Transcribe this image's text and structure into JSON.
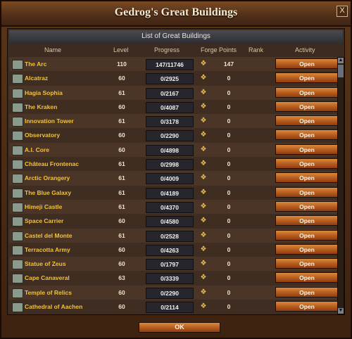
{
  "window": {
    "title": "Gedrog's Great Buildings",
    "close_label": "X"
  },
  "panel": {
    "title": "List of Great Buildings"
  },
  "columns": {
    "name": "Name",
    "level": "Level",
    "progress": "Progress",
    "forge_points": "Forge Points",
    "rank": "Rank",
    "activity": "Activity"
  },
  "rows": [
    {
      "name": "The Arc",
      "level": "110",
      "progress": "147/11746",
      "fp": "147",
      "action": "Open"
    },
    {
      "name": "Alcatraz",
      "level": "60",
      "progress": "0/2925",
      "fp": "0",
      "action": "Open"
    },
    {
      "name": "Hagia Sophia",
      "level": "61",
      "progress": "0/2167",
      "fp": "0",
      "action": "Open"
    },
    {
      "name": "The Kraken",
      "level": "60",
      "progress": "0/4087",
      "fp": "0",
      "action": "Open"
    },
    {
      "name": "Innovation Tower",
      "level": "61",
      "progress": "0/3178",
      "fp": "0",
      "action": "Open"
    },
    {
      "name": "Observatory",
      "level": "60",
      "progress": "0/2290",
      "fp": "0",
      "action": "Open"
    },
    {
      "name": "A.I. Core",
      "level": "60",
      "progress": "0/4898",
      "fp": "0",
      "action": "Open"
    },
    {
      "name": "Château Frontenac",
      "level": "61",
      "progress": "0/2998",
      "fp": "0",
      "action": "Open"
    },
    {
      "name": "Arctic Orangery",
      "level": "61",
      "progress": "0/4009",
      "fp": "0",
      "action": "Open"
    },
    {
      "name": "The Blue Galaxy",
      "level": "61",
      "progress": "0/4189",
      "fp": "0",
      "action": "Open"
    },
    {
      "name": "Himeji Castle",
      "level": "61",
      "progress": "0/4370",
      "fp": "0",
      "action": "Open"
    },
    {
      "name": "Space Carrier",
      "level": "60",
      "progress": "0/4580",
      "fp": "0",
      "action": "Open"
    },
    {
      "name": "Castel del Monte",
      "level": "61",
      "progress": "0/2528",
      "fp": "0",
      "action": "Open"
    },
    {
      "name": "Terracotta Army",
      "level": "60",
      "progress": "0/4263",
      "fp": "0",
      "action": "Open"
    },
    {
      "name": "Statue of Zeus",
      "level": "60",
      "progress": "0/1797",
      "fp": "0",
      "action": "Open"
    },
    {
      "name": "Cape Canaveral",
      "level": "63",
      "progress": "0/3339",
      "fp": "0",
      "action": "Open"
    },
    {
      "name": "Temple of Relics",
      "level": "60",
      "progress": "0/2290",
      "fp": "0",
      "action": "Open"
    },
    {
      "name": "Cathedral of Aachen",
      "level": "60",
      "progress": "0/2114",
      "fp": "0",
      "action": "Open"
    }
  ],
  "icons": {
    "building": "building-icon",
    "forge_points": "forge-points-icon"
  },
  "footer": {
    "ok_label": "OK"
  }
}
